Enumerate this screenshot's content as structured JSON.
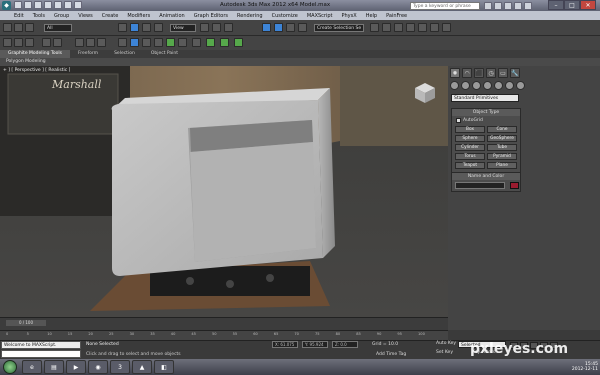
{
  "window": {
    "title": "Autodesk 3ds Max  2012 x64     Model.max",
    "search_placeholder": "Type a keyword or phrase",
    "min": "–",
    "max": "□",
    "close": "✕"
  },
  "menu": [
    "Edit",
    "Tools",
    "Group",
    "Views",
    "Create",
    "Modifiers",
    "Animation",
    "Graph Editors",
    "Rendering",
    "Customize",
    "MAXScript",
    "PhysX",
    "Help",
    "PainFree"
  ],
  "toolbar": {
    "selection_filter": "All",
    "reference_coord": "View",
    "named_selection": "Create Selection Se"
  },
  "ribbon": {
    "tabs": [
      "Graphite Modeling Tools",
      "Freeform",
      "Selection",
      "Object Paint"
    ],
    "active_tab": "Graphite Modeling Tools",
    "panel_label": "Polygon Modeling"
  },
  "viewport": {
    "label": "+ ] [ Perspective ] [ Realistic ]",
    "amp_brand": "Marshall"
  },
  "command_panel": {
    "tabs": [
      "✹",
      "◠",
      "⬛",
      "◷",
      "▭",
      "🔧"
    ],
    "category": "Standard Primitives",
    "object_type_title": "Object Type",
    "autogrid": "AutoGrid",
    "objects": [
      "Box",
      "Cone",
      "Sphere",
      "GeoSphere",
      "Cylinder",
      "Tube",
      "Torus",
      "Pyramid",
      "Teapot",
      "Plane"
    ],
    "name_color_title": "Name and Color",
    "object_color": "#9b1b2f"
  },
  "timeline": {
    "frame": "0 / 100",
    "ticks": [
      "0",
      "5",
      "10",
      "15",
      "20",
      "25",
      "30",
      "35",
      "40",
      "45",
      "50",
      "55",
      "60",
      "65",
      "70",
      "75",
      "80",
      "85",
      "90",
      "95",
      "100"
    ]
  },
  "status": {
    "maxscript": "Welcome to MAXScript.",
    "selection": "None Selected",
    "hint": "Click and drag to select and move objects",
    "x": "X: 61.075",
    "y": "Y: 95.924",
    "z": "Z: 0.0",
    "grid": "Grid = 10.0",
    "add_time_tag": "Add Time Tag",
    "auto_key": "Auto Key",
    "auto_key_mode": "Selected",
    "set_key": "Set Key",
    "key_filters": "Key Filters..."
  },
  "taskbar": {
    "apps": [
      "e",
      "▤",
      "▶",
      "◉",
      "3",
      "▲",
      "◧"
    ],
    "time": "15:45",
    "date": "2012-12-11"
  },
  "watermark": "pxleyes.com"
}
